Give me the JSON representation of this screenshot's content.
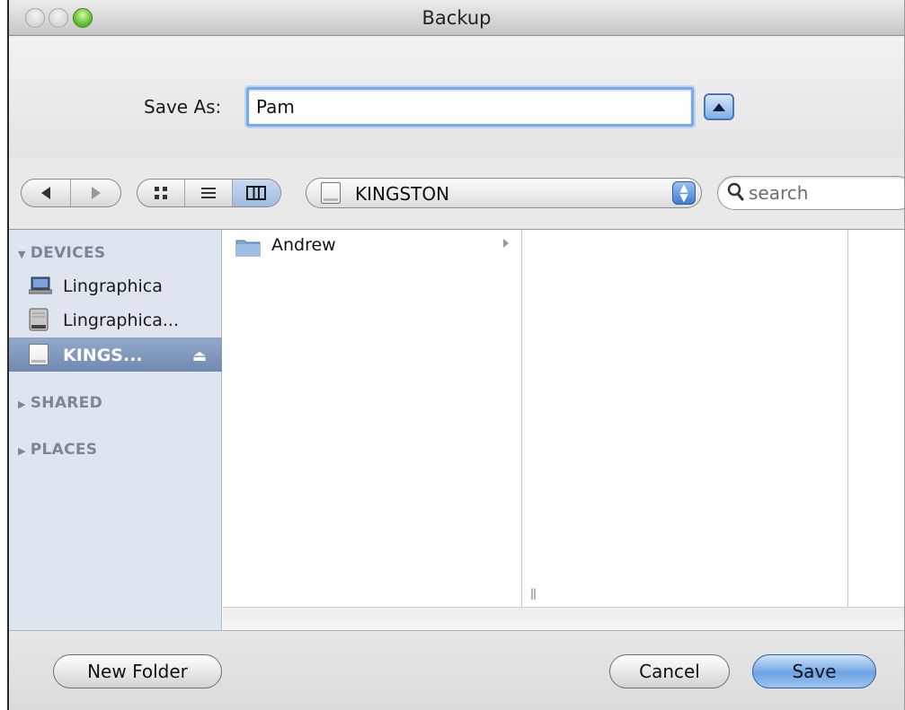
{
  "window": {
    "title": "Backup"
  },
  "save_as": {
    "label": "Save As:",
    "value": "Pam"
  },
  "toolbar": {
    "location": "KINGSTON",
    "search_placeholder": "search",
    "view_mode": "columns"
  },
  "sidebar": {
    "sections": [
      {
        "label": "DEVICES",
        "expanded": true
      },
      {
        "label": "SHARED",
        "expanded": false
      },
      {
        "label": "PLACES",
        "expanded": false
      }
    ],
    "devices": [
      {
        "label": "Lingraphica",
        "icon": "laptop-icon"
      },
      {
        "label": "Lingraphica...",
        "icon": "hard-disk-icon"
      },
      {
        "label": "KINGS...",
        "icon": "usb-drive-icon",
        "selected": true
      }
    ]
  },
  "browser": {
    "column1": [
      {
        "label": "Andrew",
        "icon": "folder-icon"
      }
    ]
  },
  "buttons": {
    "new_folder": "New Folder",
    "cancel": "Cancel",
    "save": "Save"
  },
  "colors": {
    "accent": "#6ea3e4",
    "sidebar_bg": "#dfe5ee",
    "selection": "#7a93b8"
  }
}
